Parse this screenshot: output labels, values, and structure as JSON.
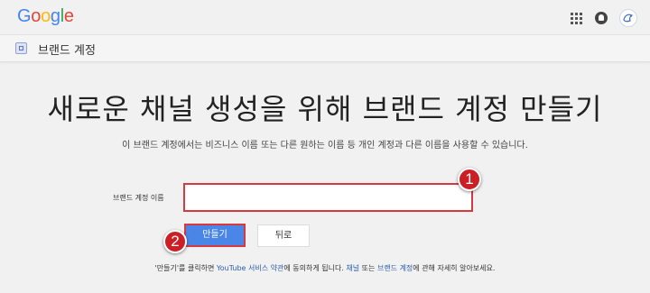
{
  "header": {
    "logo_letters": [
      {
        "char": "G",
        "color": "#4285F4"
      },
      {
        "char": "o",
        "color": "#EA4335"
      },
      {
        "char": "o",
        "color": "#FBBC05"
      },
      {
        "char": "g",
        "color": "#4285F4"
      },
      {
        "char": "l",
        "color": "#34A853"
      },
      {
        "char": "e",
        "color": "#EA4335"
      }
    ],
    "icons": [
      "apps-grid-icon",
      "notifications-icon",
      "account-avatar"
    ]
  },
  "subbar": {
    "title": "브랜드 계정"
  },
  "main": {
    "headline": "새로운 채널 생성을 위해 브랜드 계정 만들기",
    "subtitle": "이 브랜드 계정에서는 비즈니스 이름 또는 다른 원하는 이름 등 개인 계정과 다른 이름을 사용할 수 있습니다.",
    "field_label": "브랜드 계정 이름",
    "field_value": "",
    "create_label": "만들기",
    "back_label": "뒤로",
    "marker_1": "1",
    "marker_2": "2"
  },
  "footer": {
    "part1": "'만들기'를 클릭하면 ",
    "link_terms": "YouTube 서비스 약관",
    "part2": "에 동의하게 됩니다. ",
    "link_channel": "채널",
    "part3": " 또는 ",
    "link_brand": "브랜드 계정",
    "part4": "에 관해 자세히 알아보세요."
  },
  "colors": {
    "accent": "#4a86e8",
    "highlight": "#d9383c",
    "link": "#2a5db0"
  }
}
